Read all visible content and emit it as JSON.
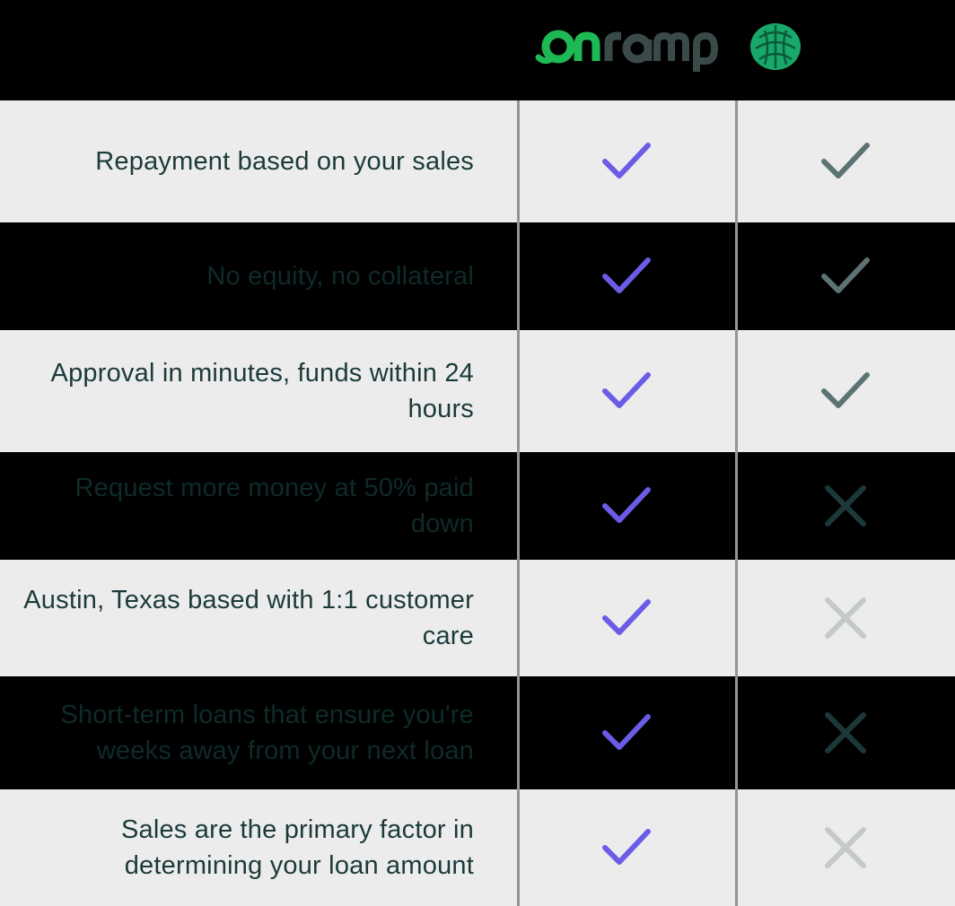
{
  "header": {
    "brand_primary": {
      "logo_text": "onramp",
      "icon": "onramp-logo",
      "color_on": "#1db954",
      "color_ramp": "#3a4a48"
    },
    "brand_competitor": {
      "icon": "brain-logo",
      "color": "#18a96a"
    }
  },
  "colors": {
    "check_primary": "#6b5ce7",
    "check_competitor": "#5d7373",
    "cross_light": "#c4cac7",
    "cross_dark": "#1d3838",
    "row_light": "#ececec",
    "row_dark": "#000000",
    "text": "#1c3a3a"
  },
  "rows": [
    {
      "feature": "Repayment based on your sales",
      "onramp": "check-icon",
      "competitor": "check-icon",
      "theme": "light"
    },
    {
      "feature": "No equity, no collateral",
      "onramp": "check-icon",
      "competitor": "check-icon",
      "theme": "dark"
    },
    {
      "feature": "Approval in minutes, funds within 24 hours",
      "onramp": "check-icon",
      "competitor": "check-icon",
      "theme": "light"
    },
    {
      "feature": "Request more money at 50% paid down",
      "onramp": "check-icon",
      "competitor": "x-icon",
      "theme": "dark"
    },
    {
      "feature": "Austin, Texas based with 1:1 customer care",
      "onramp": "check-icon",
      "competitor": "x-icon",
      "theme": "light"
    },
    {
      "feature": "Short-term loans that ensure you're weeks away from your next loan",
      "onramp": "check-icon",
      "competitor": "x-icon",
      "theme": "dark"
    },
    {
      "feature": "Sales are the primary factor in determining your loan amount",
      "onramp": "check-icon",
      "competitor": "x-icon",
      "theme": "light"
    }
  ]
}
